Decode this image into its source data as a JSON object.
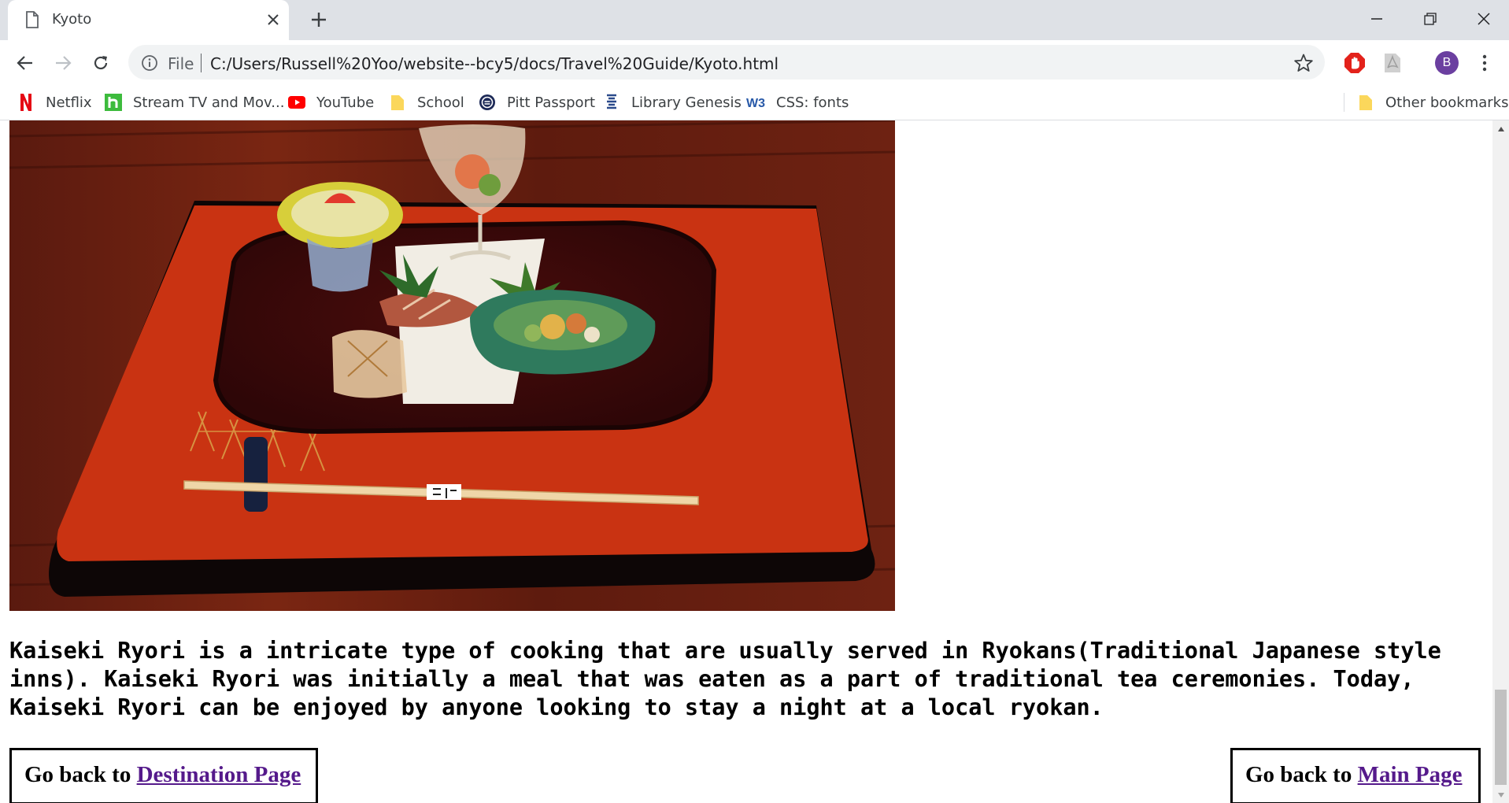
{
  "tab": {
    "title": "Kyoto"
  },
  "omnibox": {
    "scheme": "File",
    "url": "C:/Users/Russell%20Yoo/website--bcy5/docs/Travel%20Guide/Kyoto.html"
  },
  "profile": {
    "initial": "B"
  },
  "bookmarks": {
    "items": [
      {
        "label": "Netflix",
        "icon": "netflix-icon"
      },
      {
        "label": "Stream TV and Mov...",
        "icon": "hulu-icon"
      },
      {
        "label": "YouTube",
        "icon": "youtube-icon"
      },
      {
        "label": "School",
        "icon": "folder-icon"
      },
      {
        "label": "Pitt Passport",
        "icon": "pitt-icon"
      },
      {
        "label": "Library Genesis",
        "icon": "libgen-icon"
      },
      {
        "label": "CSS: fonts",
        "icon": "w3schools-icon"
      }
    ],
    "other": "Other bookmarks"
  },
  "page": {
    "paragraph": "Kaiseki Ryori is a intricate type of cooking that are usually served in Ryokans(Traditional Japanese style inns). Kaiseki Ryori was initially a meal that was eaten as a part of traditional tea ceremonies. Today, Kaiseki Ryori can be enjoyed by anyone looking to stay a night at a local ryokan.",
    "nav_left": {
      "prefix": "Go back to ",
      "link": "Destination Page"
    },
    "nav_right": {
      "prefix": "Go back to ",
      "link": "Main Page"
    }
  },
  "colors": {
    "tabstrip": "#dee1e6",
    "link": "#551a8b",
    "tray": "#c93312",
    "table_wood": "#6e1d10"
  }
}
